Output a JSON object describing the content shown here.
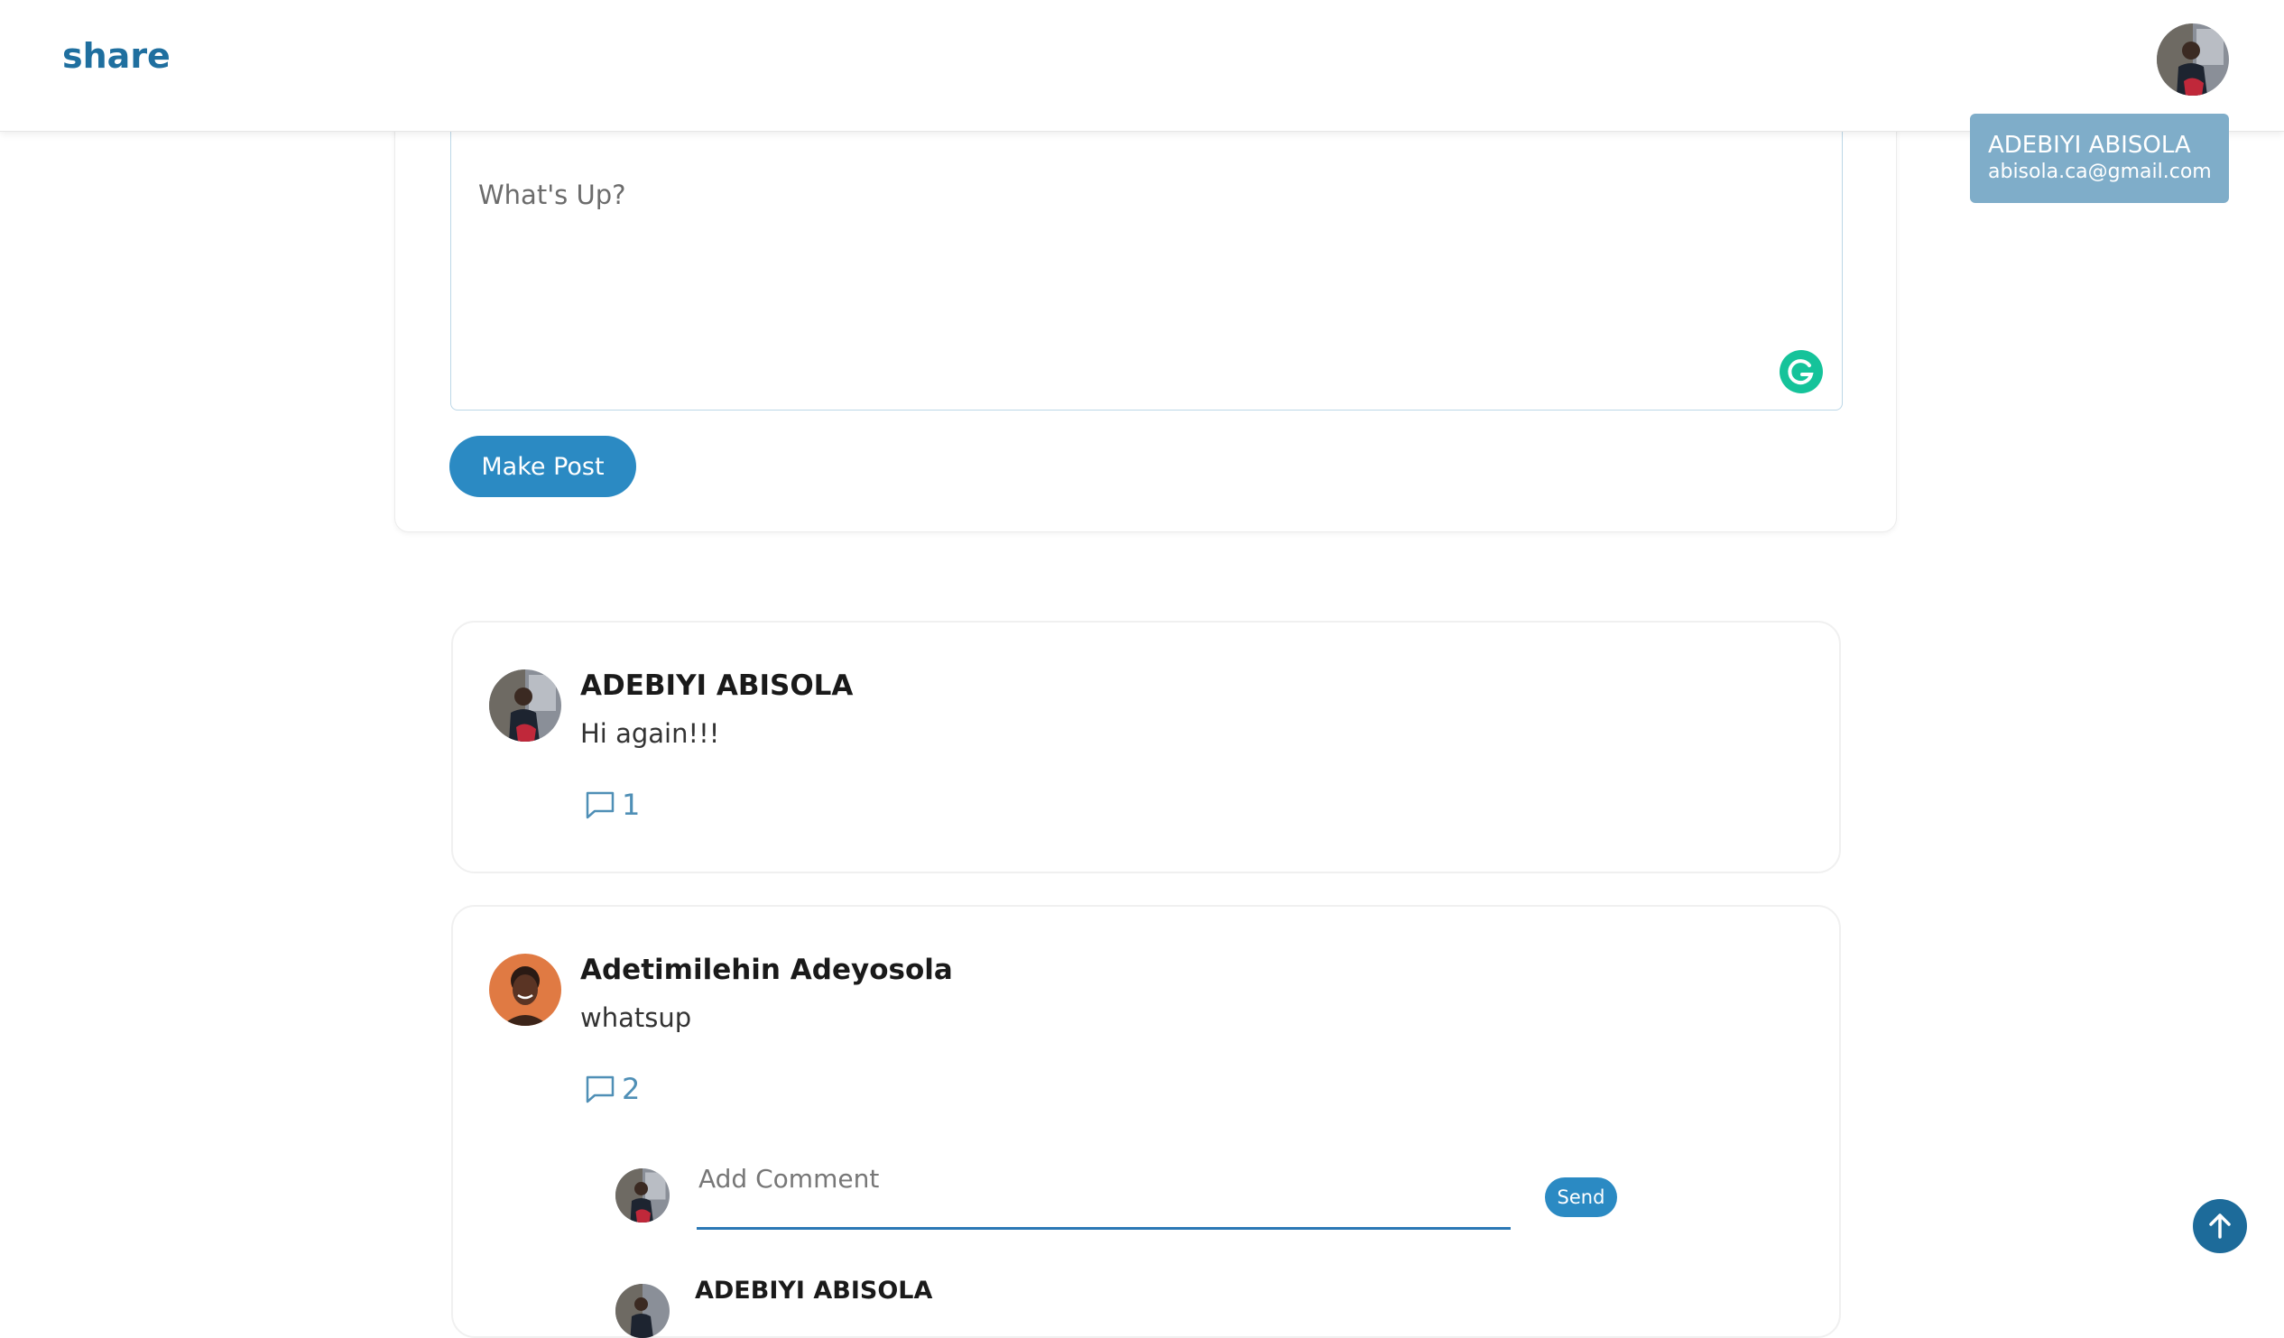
{
  "header": {
    "brand": "share"
  },
  "user_card": {
    "name": "ADEBIYI ABISOLA",
    "email": "abisola.ca@gmail.com"
  },
  "composer": {
    "placeholder": "What's Up?",
    "submit_label": "Make Post"
  },
  "posts": [
    {
      "author": "ADEBIYI ABISOLA",
      "text": "Hi again!!!",
      "comment_count": "1",
      "icon": "comment-icon"
    },
    {
      "author": "Adetimilehin Adeyosola",
      "text": "whatsup",
      "comment_count": "2",
      "icon": "comment-icon",
      "comment_box": {
        "placeholder": "Add Comment",
        "send_label": "Send"
      },
      "first_reply_author": "ADEBIYI ABISOLA"
    }
  ],
  "colors": {
    "brand": "#1f6f9f",
    "primary_button": "#2b8ac3",
    "user_card_bg": "#7fadc9",
    "scroll_top_bg": "#1d6b9a",
    "grammarly": "#15c39a"
  },
  "icons": {
    "scroll_top": "arrow-up-icon",
    "grammarly": "grammarly-icon"
  }
}
